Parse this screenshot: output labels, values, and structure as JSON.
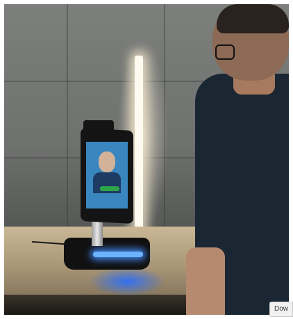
{
  "download": {
    "label": "Dow"
  }
}
